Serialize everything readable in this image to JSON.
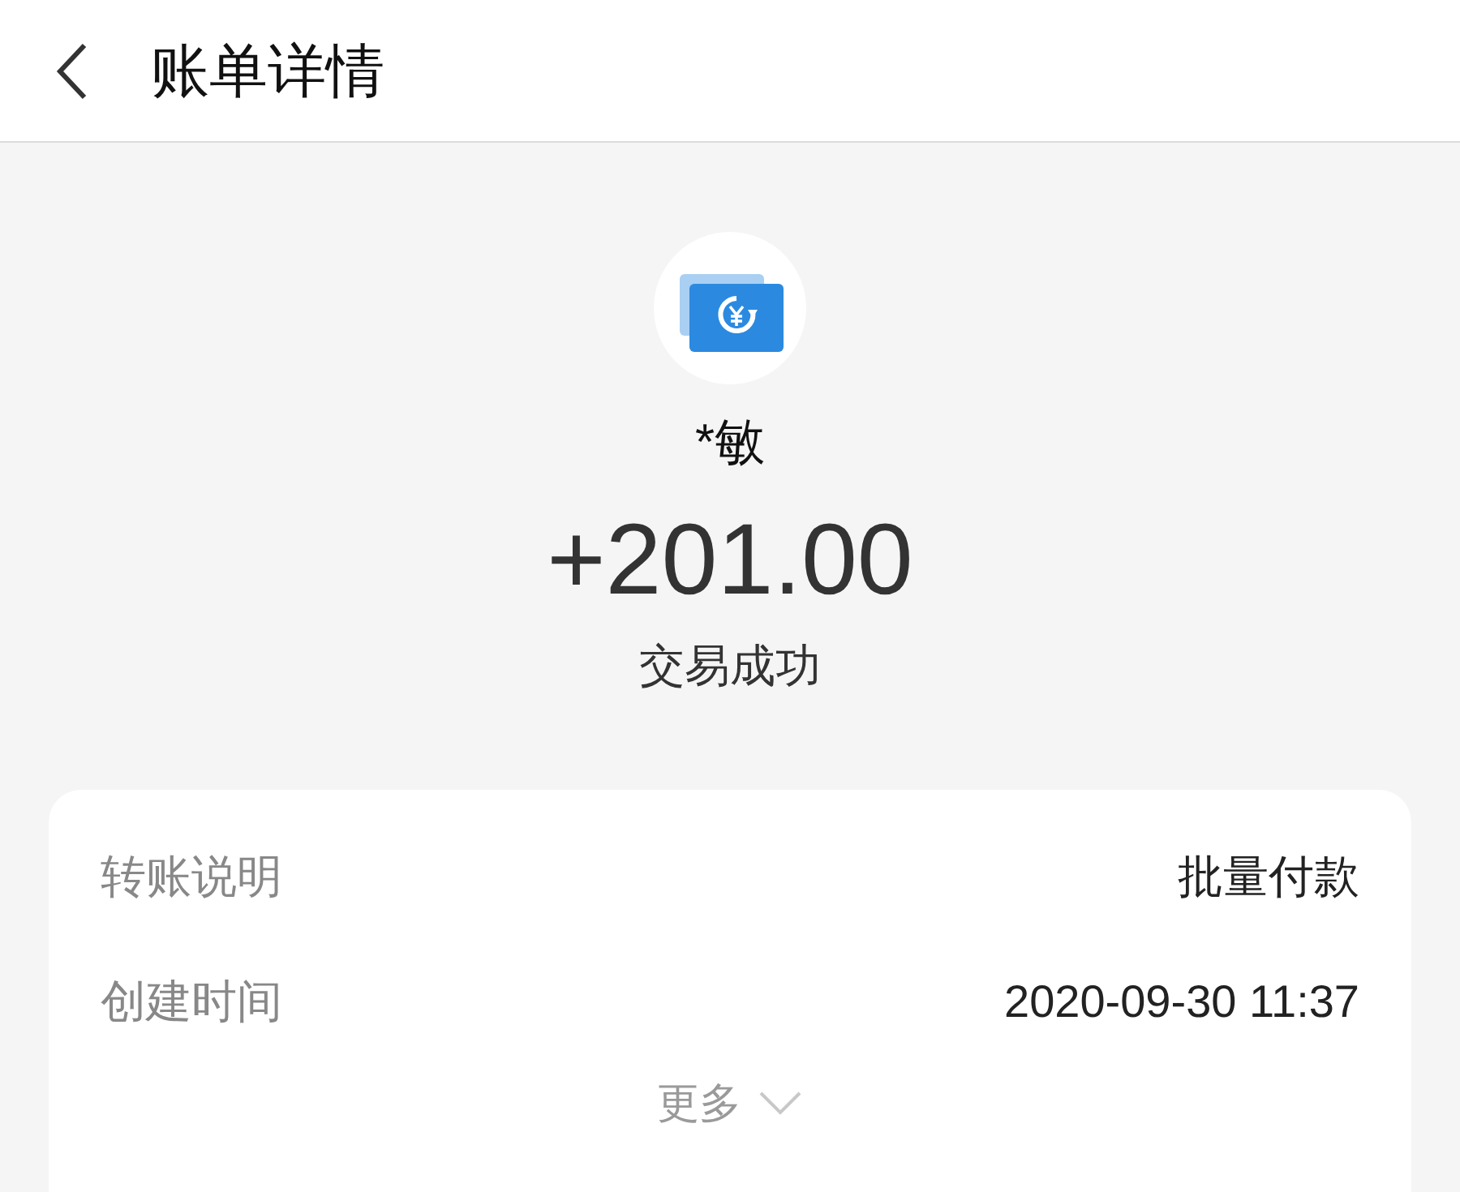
{
  "header": {
    "title": "账单详情"
  },
  "payee": {
    "name": "*敏"
  },
  "amount": "+201.00",
  "status": "交易成功",
  "details": [
    {
      "label": "转账说明",
      "value": "批量付款"
    },
    {
      "label": "创建时间",
      "value": "2020-09-30 11:37"
    }
  ],
  "more": {
    "label": "更多",
    "expanded": false
  }
}
